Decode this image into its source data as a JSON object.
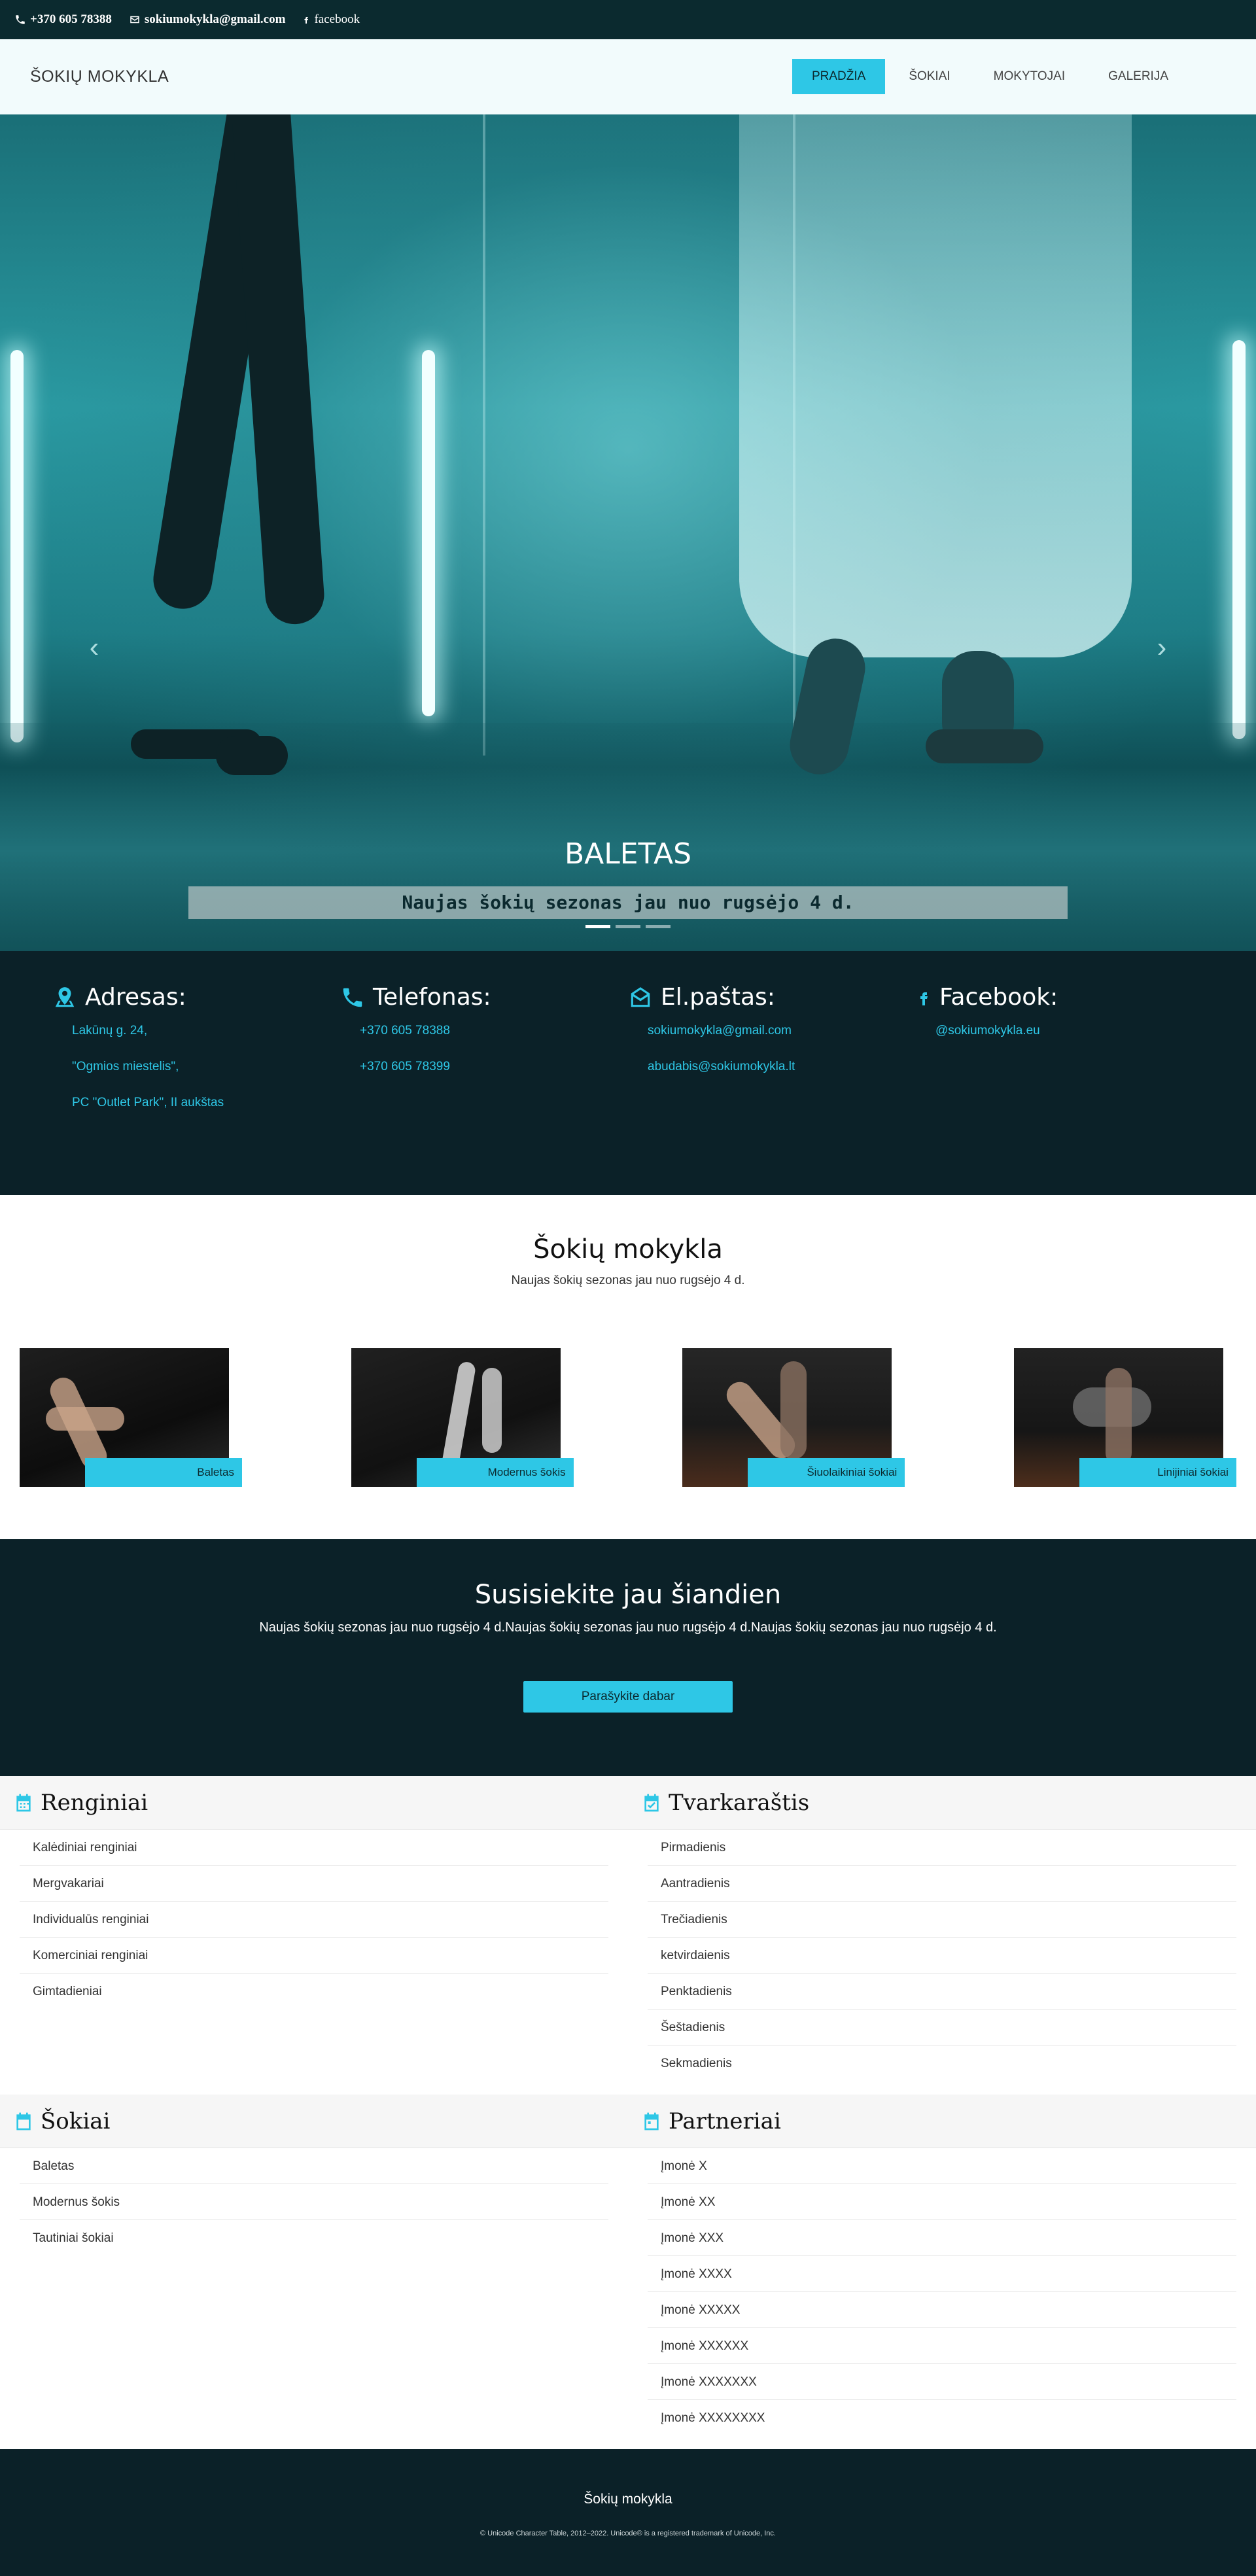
{
  "topbar": {
    "phone": "+370 605 78388",
    "email": "sokiumokykla@gmail.com",
    "facebook": "facebook",
    "phone_icon": "phone-icon",
    "email_icon": "envelope-icon",
    "facebook_icon": "facebook-icon"
  },
  "navbar": {
    "brand": "ŠOKIŲ MOKYKLA",
    "items": [
      {
        "label": "PRADŽIA",
        "active": true
      },
      {
        "label": "ŠOKIAI",
        "active": false
      },
      {
        "label": "MOKYTOJAI",
        "active": false
      },
      {
        "label": "GALERIJA",
        "active": false
      }
    ]
  },
  "hero": {
    "title": "BALETAS",
    "subtitle": "Naujas šokių sezonas jau nuo rugsėjo 4 d.",
    "prev_icon": "chevron-left-icon",
    "next_icon": "chevron-right-icon",
    "prev_glyph": "‹",
    "next_glyph": "›",
    "slide_count": 3,
    "active_slide": 1
  },
  "info": {
    "address": {
      "title": "Adresas:",
      "icon": "map-marker-icon",
      "lines": [
        "Lakūnų g. 24,",
        "\"Ogmios miestelis\",",
        "PC \"Outlet Park\", II aukštas"
      ]
    },
    "phone": {
      "title": "Telefonas:",
      "icon": "phone-icon",
      "lines": [
        "+370 605 78388",
        "+370 605 78399"
      ]
    },
    "email": {
      "title": "El.paštas:",
      "icon": "envelope-open-icon",
      "lines": [
        "sokiumokykla@gmail.com",
        "abudabis@sokiumokykla.lt"
      ]
    },
    "facebook": {
      "title": "Facebook:",
      "icon": "facebook-icon",
      "lines": [
        "@sokiumokykla.eu"
      ]
    }
  },
  "school": {
    "title": "Šokių mokykla",
    "subtitle": "Naujas šokių sezonas jau nuo rugsėjo 4 d.",
    "cards": [
      {
        "label": "Baletas"
      },
      {
        "label": "Modernus šokis"
      },
      {
        "label": "Šiuolaikiniai šokiai"
      },
      {
        "label": "Linijiniai šokiai"
      }
    ]
  },
  "cta": {
    "title": "Susisiekite jau šiandien",
    "text": "Naujas šokių sezonas jau nuo rugsėjo 4 d.Naujas šokių sezonas jau nuo rugsėjo 4 d.Naujas šokių sezonas jau nuo rugsėjo 4 d.",
    "button": "Parašykite dabar"
  },
  "lists": {
    "events": {
      "title": "Renginiai",
      "icon": "calendar-icon",
      "items": [
        "Kalėdiniai renginiai",
        "Mergvakariai",
        "Individualūs renginiai",
        "Komerciniai renginiai",
        "Gimtadieniai"
      ]
    },
    "schedule": {
      "title": "Tvarkaraštis",
      "icon": "calendar-check-icon",
      "items": [
        "Pirmadienis",
        "Aantradienis",
        "Trečiadienis",
        "ketvirdaienis",
        "Penktadienis",
        "Šeštadienis",
        "Sekmadienis"
      ]
    },
    "dances": {
      "title": "Šokiai",
      "icon": "calendar-icon",
      "items": [
        "Baletas",
        "Modernus šokis",
        "Tautiniai šokiai"
      ]
    },
    "partners": {
      "title": "Partneriai",
      "icon": "calendar-icon",
      "items": [
        "Įmonė X",
        "Įmonė XX",
        "Įmonė XXX",
        "Įmonė XXXX",
        "Įmonė XXXXX",
        "Įmonė XXXXXX",
        "Įmonė XXXXXXX",
        "Įmonė XXXXXXXX"
      ]
    }
  },
  "footer": {
    "name": "Šokių mokykla",
    "copyright": "© Unicode Character Table, 2012–2022. Unicode® is a registered trademark of Unicode, Inc."
  },
  "colors": {
    "accent": "#2ec7e6",
    "dark": "#0b2128",
    "topbar": "#0b2a2f",
    "nav_bg": "#f2fbfc"
  }
}
